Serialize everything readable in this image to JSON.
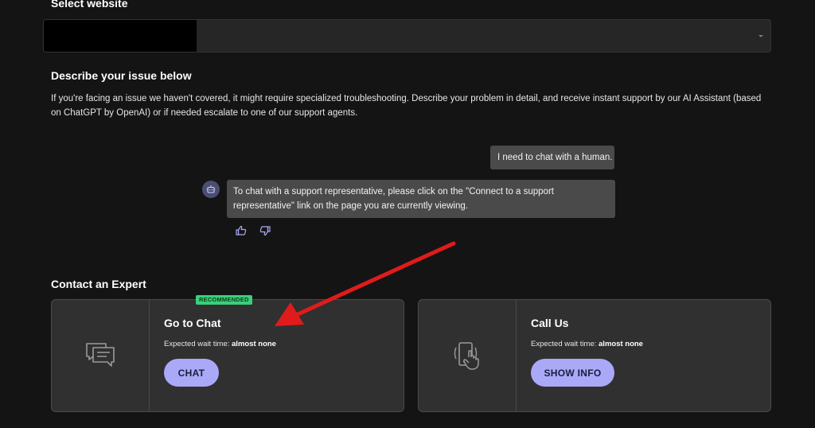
{
  "select_website": {
    "title": "Select website"
  },
  "describe": {
    "title": "Describe your issue below",
    "text": "If you're facing an issue we haven't covered, it might require specialized troubleshooting. Describe your problem in detail, and receive instant support by our AI Assistant (based on ChatGPT by OpenAI) or if needed escalate to one of our support agents."
  },
  "chat": {
    "user_message": "I need to chat with a human.",
    "bot_message": "To chat with a support representative, please click on the \"Connect to a support representative\" link on the page you are currently viewing.",
    "bot_avatar_icon": "robot-icon",
    "feedback_up_icon": "thumbs-up-icon",
    "feedback_down_icon": "thumbs-down-icon"
  },
  "contact": {
    "title": "Contact an Expert",
    "chat_card": {
      "badge": "RECOMMENDED",
      "title": "Go to Chat",
      "wait_label": "Expected wait time:",
      "wait_value": "almost none",
      "button": "CHAT",
      "icon": "chat-bubbles-icon"
    },
    "call_card": {
      "title": "Call Us",
      "wait_label": "Expected wait time:",
      "wait_value": "almost none",
      "button": "SHOW INFO",
      "icon": "phone-tap-icon"
    }
  },
  "colors": {
    "background": "#141414",
    "card": "#303030",
    "button": "#a9a9f8",
    "badge": "#3ad07a",
    "annotation_arrow": "#e01b1b"
  }
}
